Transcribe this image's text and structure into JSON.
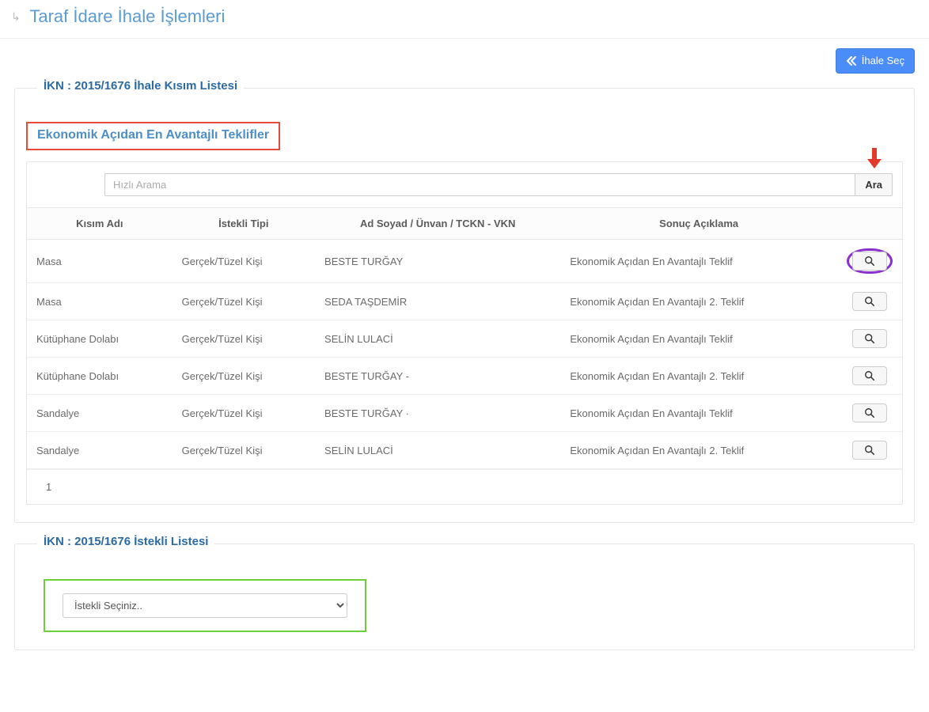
{
  "page_title": "Taraf İdare İhale İşlemleri",
  "top_button": {
    "label": "İhale Seç"
  },
  "section1": {
    "legend": "İKN : 2015/1676 İhale Kısım Listesi",
    "highlight_title": "Ekonomik Açıdan En Avantajlı Teklifler",
    "search_placeholder": "Hızlı Arama",
    "search_button": "Ara",
    "columns": {
      "kisim": "Kısım Adı",
      "istekli_tipi": "İstekli Tipi",
      "ad": "Ad Soyad / Ünvan / TCKN - VKN",
      "sonuc": "Sonuç Açıklama"
    },
    "rows": [
      {
        "kisim": "Masa",
        "tip": "Gerçek/Tüzel Kişi",
        "ad": "BESTE TURĞAY",
        "sonuc": "Ekonomik Açıdan En Avantajlı Teklif"
      },
      {
        "kisim": "Masa",
        "tip": "Gerçek/Tüzel Kişi",
        "ad": "SEDA TAŞDEMİR",
        "sonuc": "Ekonomik Açıdan En Avantajlı 2. Teklif"
      },
      {
        "kisim": "Kütüphane Dolabı",
        "tip": "Gerçek/Tüzel Kişi",
        "ad": "SELİN LULACİ",
        "sonuc": "Ekonomik Açıdan En Avantajlı Teklif"
      },
      {
        "kisim": "Kütüphane Dolabı",
        "tip": "Gerçek/Tüzel Kişi",
        "ad": "BESTE TURĞAY -",
        "sonuc": "Ekonomik Açıdan En Avantajlı 2. Teklif"
      },
      {
        "kisim": "Sandalye",
        "tip": "Gerçek/Tüzel Kişi",
        "ad": "BESTE TURĞAY ·",
        "sonuc": "Ekonomik Açıdan En Avantajlı Teklif"
      },
      {
        "kisim": "Sandalye",
        "tip": "Gerçek/Tüzel Kişi",
        "ad": "SELİN LULACİ",
        "sonuc": "Ekonomik Açıdan En Avantajlı 2. Teklif"
      }
    ],
    "page_number": "1"
  },
  "section2": {
    "legend": "İKN : 2015/1676 İstekli Listesi",
    "select_placeholder": "İstekli Seçiniz.."
  }
}
